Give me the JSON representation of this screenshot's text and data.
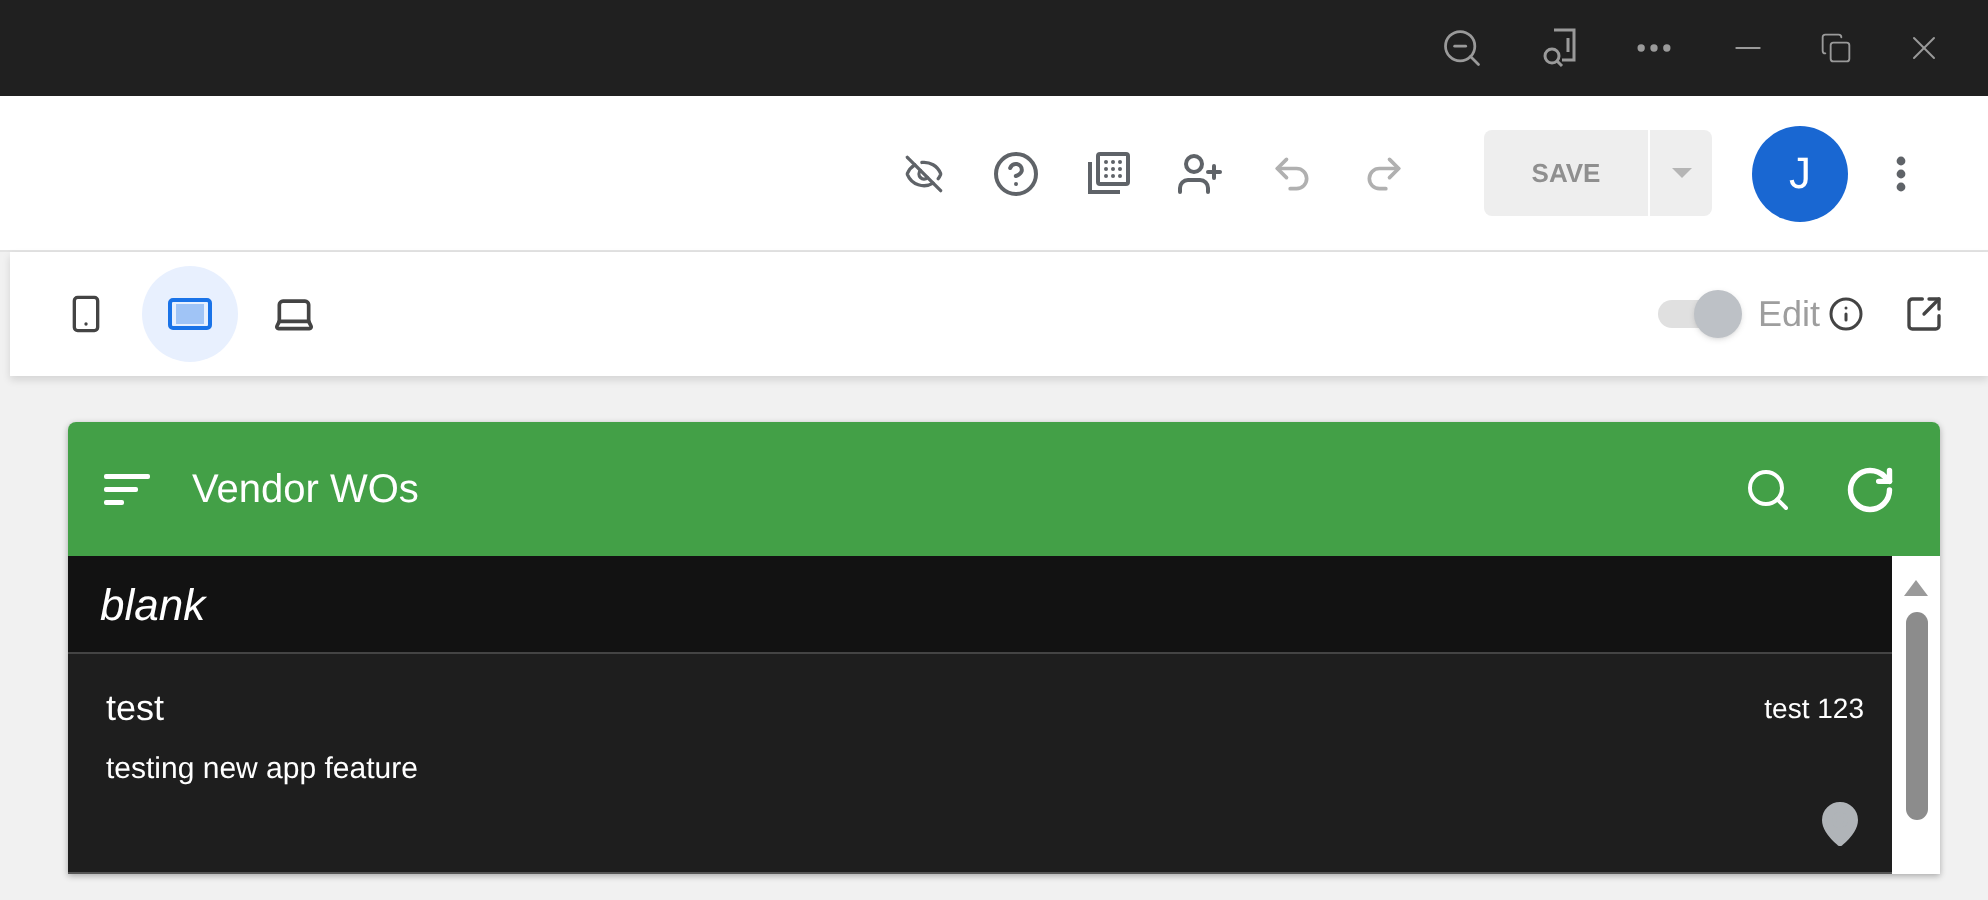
{
  "toolbar": {
    "save": {
      "label": "SAVE",
      "disabled": true
    },
    "undo": {
      "disabled": true
    },
    "redo": {
      "disabled": true
    },
    "avatar": {
      "initial": "J"
    }
  },
  "devices": [
    {
      "kind": "phone",
      "selected": false
    },
    {
      "kind": "tablet",
      "selected": true
    },
    {
      "kind": "laptop",
      "selected": false
    }
  ],
  "edit_toggle": {
    "label": "Edit",
    "on": true,
    "disabled": true
  },
  "app": {
    "title": "Vendor WOs",
    "group": {
      "label": "blank"
    },
    "rows": [
      {
        "title": "test",
        "subtitle": "testing new app feature",
        "tag": "test 123"
      }
    ]
  }
}
